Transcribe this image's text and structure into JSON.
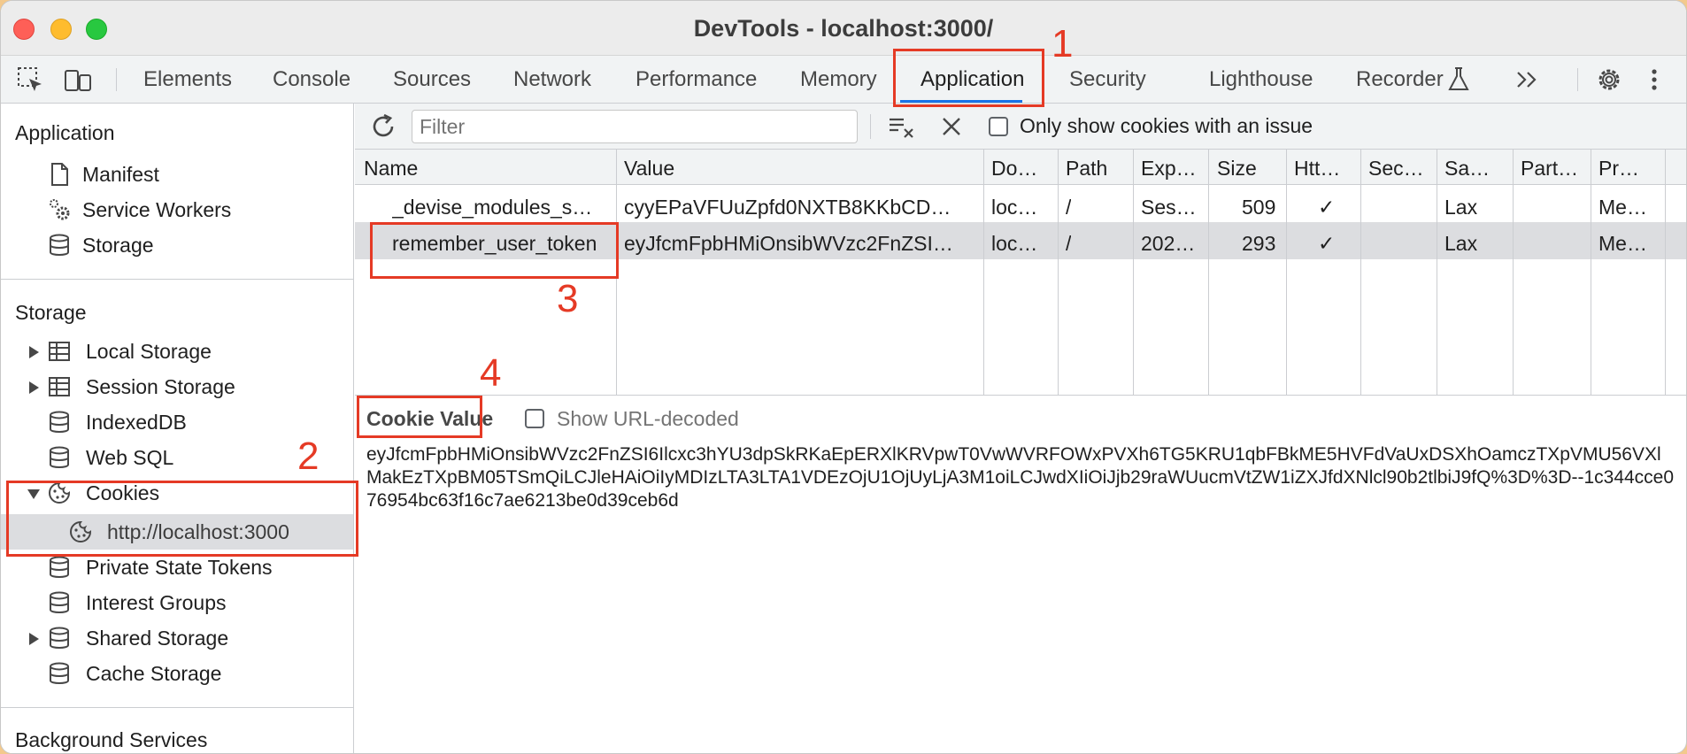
{
  "window": {
    "title": "DevTools - localhost:3000/"
  },
  "tabs": [
    {
      "label": "Elements"
    },
    {
      "label": "Console"
    },
    {
      "label": "Sources"
    },
    {
      "label": "Network"
    },
    {
      "label": "Performance"
    },
    {
      "label": "Memory"
    },
    {
      "label": "Application"
    },
    {
      "label": "Security"
    },
    {
      "label": "Lighthouse"
    },
    {
      "label": "Recorder"
    }
  ],
  "active_tab": "Application",
  "sidebar": {
    "application_header": "Application",
    "application_items": [
      {
        "label": "Manifest",
        "icon": "document-icon"
      },
      {
        "label": "Service Workers",
        "icon": "gears-icon"
      },
      {
        "label": "Storage",
        "icon": "database-icon"
      }
    ],
    "storage_header": "Storage",
    "storage_items": [
      {
        "label": "Local Storage",
        "icon": "table-icon",
        "expandable": true
      },
      {
        "label": "Session Storage",
        "icon": "table-icon",
        "expandable": true
      },
      {
        "label": "IndexedDB",
        "icon": "database-icon"
      },
      {
        "label": "Web SQL",
        "icon": "database-icon"
      },
      {
        "label": "Cookies",
        "icon": "cookie-icon",
        "expanded": true
      },
      {
        "label": "http://localhost:3000",
        "icon": "cookie-icon",
        "selected": true
      },
      {
        "label": "Private State Tokens",
        "icon": "database-icon"
      },
      {
        "label": "Interest Groups",
        "icon": "database-icon"
      },
      {
        "label": "Shared Storage",
        "icon": "database-icon",
        "expandable": true
      },
      {
        "label": "Cache Storage",
        "icon": "database-icon"
      }
    ],
    "background_header": "Background Services"
  },
  "toolbar": {
    "filter_placeholder": "Filter",
    "only_issues_label": "Only show cookies with an issue"
  },
  "cookies_table": {
    "columns": [
      "Name",
      "Value",
      "Do…",
      "Path",
      "Exp…",
      "Size",
      "Htt…",
      "Sec…",
      "Sa…",
      "Part…",
      "Pr…"
    ],
    "rows": [
      {
        "name": "_devise_modules_s…",
        "value": "cyyEPaVFUuZpfd0NXTB8KKbCD…",
        "domain": "loc…",
        "path": "/",
        "expires": "Ses…",
        "size": "509",
        "httponly": "✓",
        "secure": "",
        "samesite": "Lax",
        "partition": "",
        "priority": "Me…"
      },
      {
        "name": "remember_user_token",
        "value": "eyJfcmFpbHMiOnsibWVzc2FnZSI…",
        "domain": "loc…",
        "path": "/",
        "expires": "202…",
        "size": "293",
        "httponly": "✓",
        "secure": "",
        "samesite": "Lax",
        "partition": "",
        "priority": "Me…",
        "selected": true
      }
    ]
  },
  "cookie_value": {
    "title": "Cookie Value",
    "show_decoded_label": "Show URL-decoded",
    "value": "eyJfcmFpbHMiOnsibWVzc2FnZSI6Ilcxc3hYU3dpSkRKaEpERXlKRVpwT0VwWVRFOWxPVXh6TG5KRU1qbFBkME5HVFdVaUxDSXhOamczTXpVMU56VXlMakEzTXpBM05TSmQiLCJleHAiOiIyMDIzLTA3LTA1VDEzOjU1OjUyLjA3M1oiLCJwdXIiOiJjb29raWUucmVtZW1iZXJfdXNlcl90b2tlbiJ9fQ%3D%3D--1c344cce076954bc63f16c7ae6213be0d39ceb6d"
  },
  "annotations": [
    "1",
    "2",
    "3",
    "4"
  ],
  "colors": {
    "accent": "#1a73e8",
    "annotation": "#e53a25",
    "selection": "#dcdde0"
  }
}
